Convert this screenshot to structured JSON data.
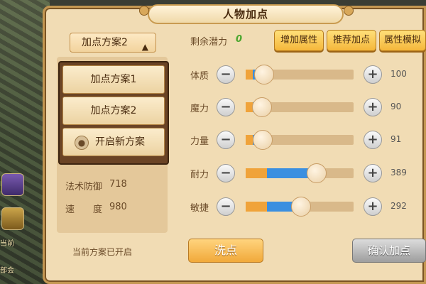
{
  "title": "人物加点",
  "scheme_selector": {
    "label": "加点方案2"
  },
  "dropdown": {
    "items": [
      "加点方案1",
      "加点方案2"
    ],
    "new_label": "开启新方案"
  },
  "left_stats": [
    {
      "label": "法术防御",
      "value": "718"
    },
    {
      "label": "速　　度",
      "value": "980"
    }
  ],
  "status_text": "当前方案已开启",
  "potential": {
    "label": "剩余潜力",
    "value": "0"
  },
  "top_buttons": [
    "增加属性",
    "推荐加点",
    "属性模拟"
  ],
  "attributes": [
    {
      "label": "体质",
      "value": "100",
      "base_fraction": 0.0,
      "new_fraction": 0.17
    },
    {
      "label": "魔力",
      "value": "90",
      "base_fraction": 0.0,
      "new_fraction": 0.15
    },
    {
      "label": "力量",
      "value": "91",
      "base_fraction": 0.0,
      "new_fraction": 0.16
    },
    {
      "label": "耐力",
      "value": "389",
      "base_fraction": 0.2,
      "new_fraction": 0.66
    },
    {
      "label": "敏捷",
      "value": "292",
      "base_fraction": 0.2,
      "new_fraction": 0.51
    }
  ],
  "buttons": {
    "wash": "洗点",
    "confirm": "确认加点"
  },
  "background": {
    "side_texts": [
      "当前",
      "部会"
    ]
  },
  "colors": {
    "accent_orange": "#f0a33a",
    "accent_blue": "#3b8fe0",
    "potential_green": "#4aa62d"
  }
}
